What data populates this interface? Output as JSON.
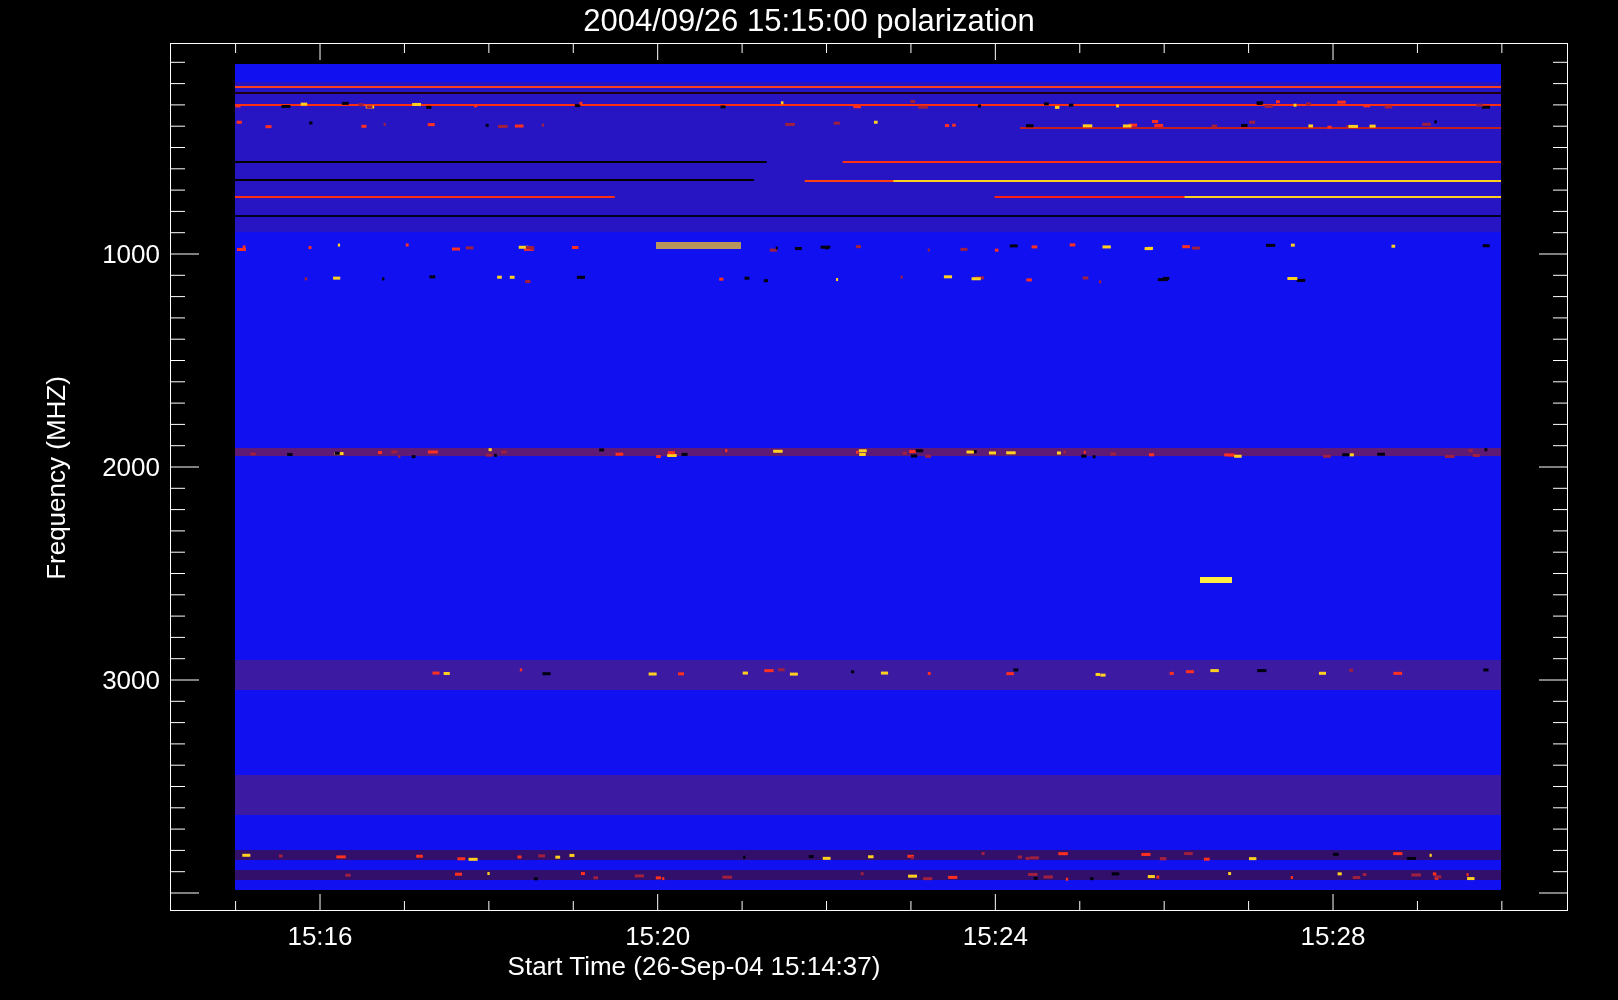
{
  "title": "2004/09/26 15:15:00 polarization",
  "y_axis": {
    "title": "Frequency (MHZ)",
    "ticks": [
      "1000",
      "2000",
      "3000"
    ]
  },
  "x_axis": {
    "title": "Start Time (26-Sep-04 15:14:37)",
    "ticks": [
      "15:16",
      "15:20",
      "15:24",
      "15:28"
    ]
  }
}
